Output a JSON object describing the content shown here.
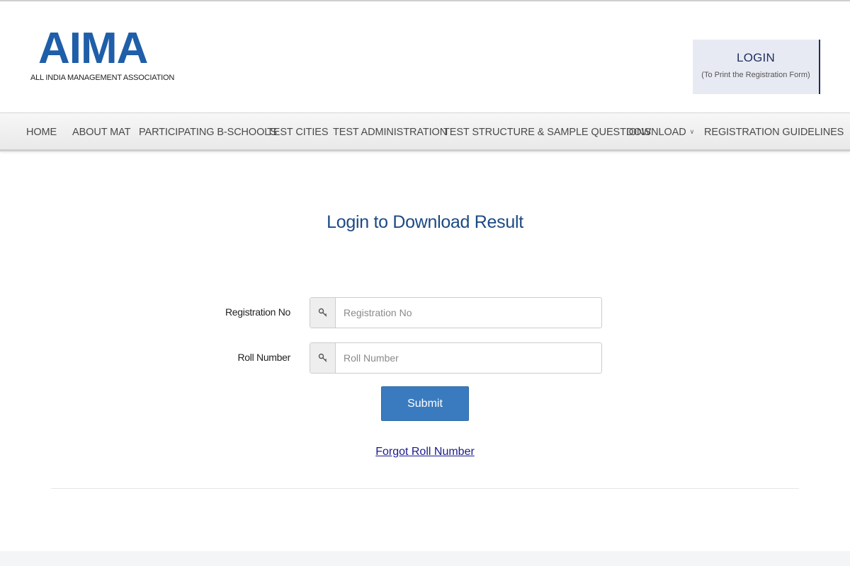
{
  "header": {
    "logo_text": "AIMA",
    "logo_subtitle": "ALL INDIA MANAGEMENT ASSOCIATION",
    "login": {
      "title": "LOGIN",
      "subtitle": "(To Print the Registration Form)"
    }
  },
  "nav": {
    "items": [
      {
        "label": "HOME"
      },
      {
        "label": "ABOUT MAT"
      },
      {
        "label": "PARTICIPATING B-SCHOOLS"
      },
      {
        "label": "TEST CITIES"
      },
      {
        "label": "TEST ADMINISTRATION"
      },
      {
        "label": "TEST STRUCTURE & SAMPLE QUESTIONS"
      },
      {
        "label": "DOWNLOAD",
        "has_dropdown": true
      },
      {
        "label": "REGISTRATION GUIDELINES"
      }
    ]
  },
  "main": {
    "title": "Login to Download Result",
    "fields": [
      {
        "label": "Registration No",
        "placeholder": "Registration No",
        "value": "",
        "icon": "key-icon"
      },
      {
        "label": "Roll Number",
        "placeholder": "Roll Number",
        "value": "",
        "icon": "key-icon"
      }
    ],
    "submit_label": "Submit",
    "forgot_link": "Forgot Roll Number"
  },
  "colors": {
    "brand_blue": "#1f5ea8",
    "title_blue": "#1c4a84",
    "button_blue": "#3a7bbf",
    "link_blue": "#1a1a8c",
    "login_box_bg": "#e8eaf3"
  }
}
